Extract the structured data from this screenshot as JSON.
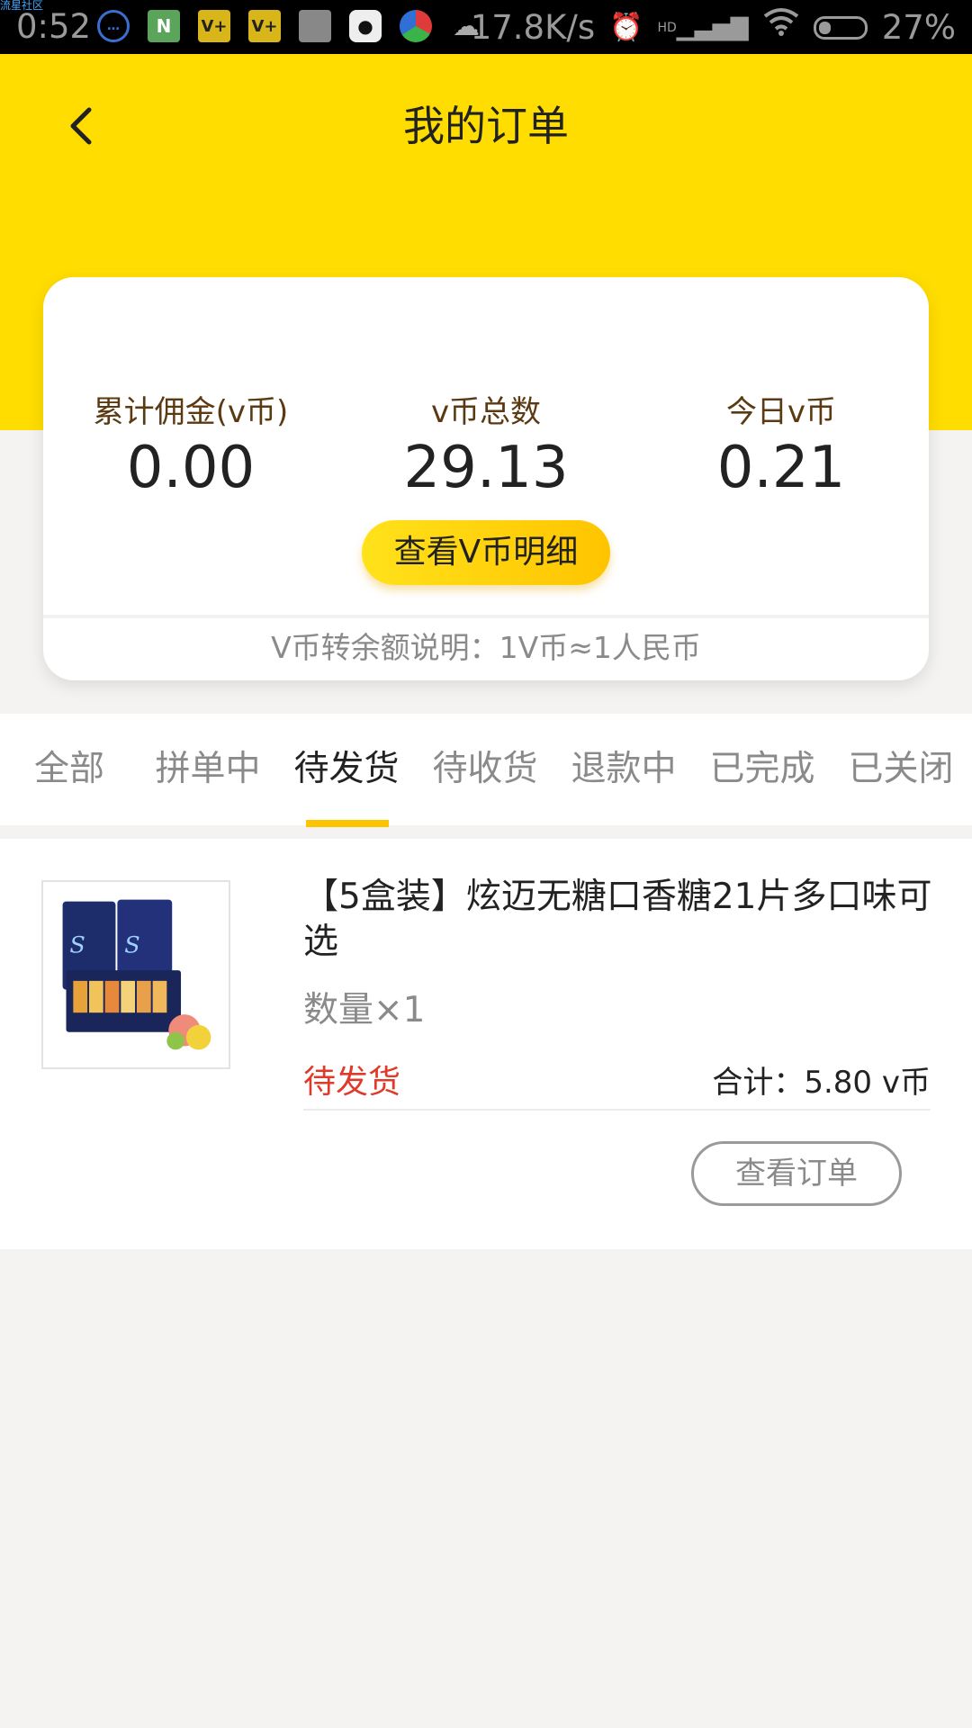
{
  "status_bar": {
    "brand_tag": "流星社区",
    "time": "0:52",
    "net_speed": "17.8K/s",
    "network_label": "HD",
    "battery": "27%",
    "battery_level": 0.27,
    "notification_icons": [
      "chat-bubble-icon",
      "green-app-icon",
      "vplus-app-icon",
      "vplus-app-icon",
      "photo-thumbnail-icon",
      "qq-penguin-icon",
      "colorful-ball-icon",
      "cloud-weather-icon"
    ]
  },
  "header": {
    "title": "我的订单",
    "back_icon": "chevron-left-icon",
    "background_color": "#ffdd00"
  },
  "summary": {
    "stats": [
      {
        "label": "累计佣金(v币)",
        "value": "0.00"
      },
      {
        "label": "v币总数",
        "value": "29.13"
      },
      {
        "label": "今日v币",
        "value": "0.21"
      }
    ],
    "detail_button": "查看V币明细",
    "note": "V币转余额说明：1V币≈1人民币"
  },
  "tabs": [
    {
      "label": "全部",
      "active": false
    },
    {
      "label": "拼单中",
      "active": false
    },
    {
      "label": "待发货",
      "active": true
    },
    {
      "label": "待收货",
      "active": false
    },
    {
      "label": "退款中",
      "active": false
    },
    {
      "label": "已完成",
      "active": false
    },
    {
      "label": "已关闭",
      "active": false
    }
  ],
  "order": {
    "title": "【5盒装】炫迈无糖口香糖21片多口味可选",
    "quantity": "数量×1",
    "status": "待发货",
    "total": "合计：5.80 v币",
    "view_button": "查看订单"
  },
  "colors": {
    "accent_yellow": "#ffc400",
    "status_red": "#e03a2b"
  }
}
